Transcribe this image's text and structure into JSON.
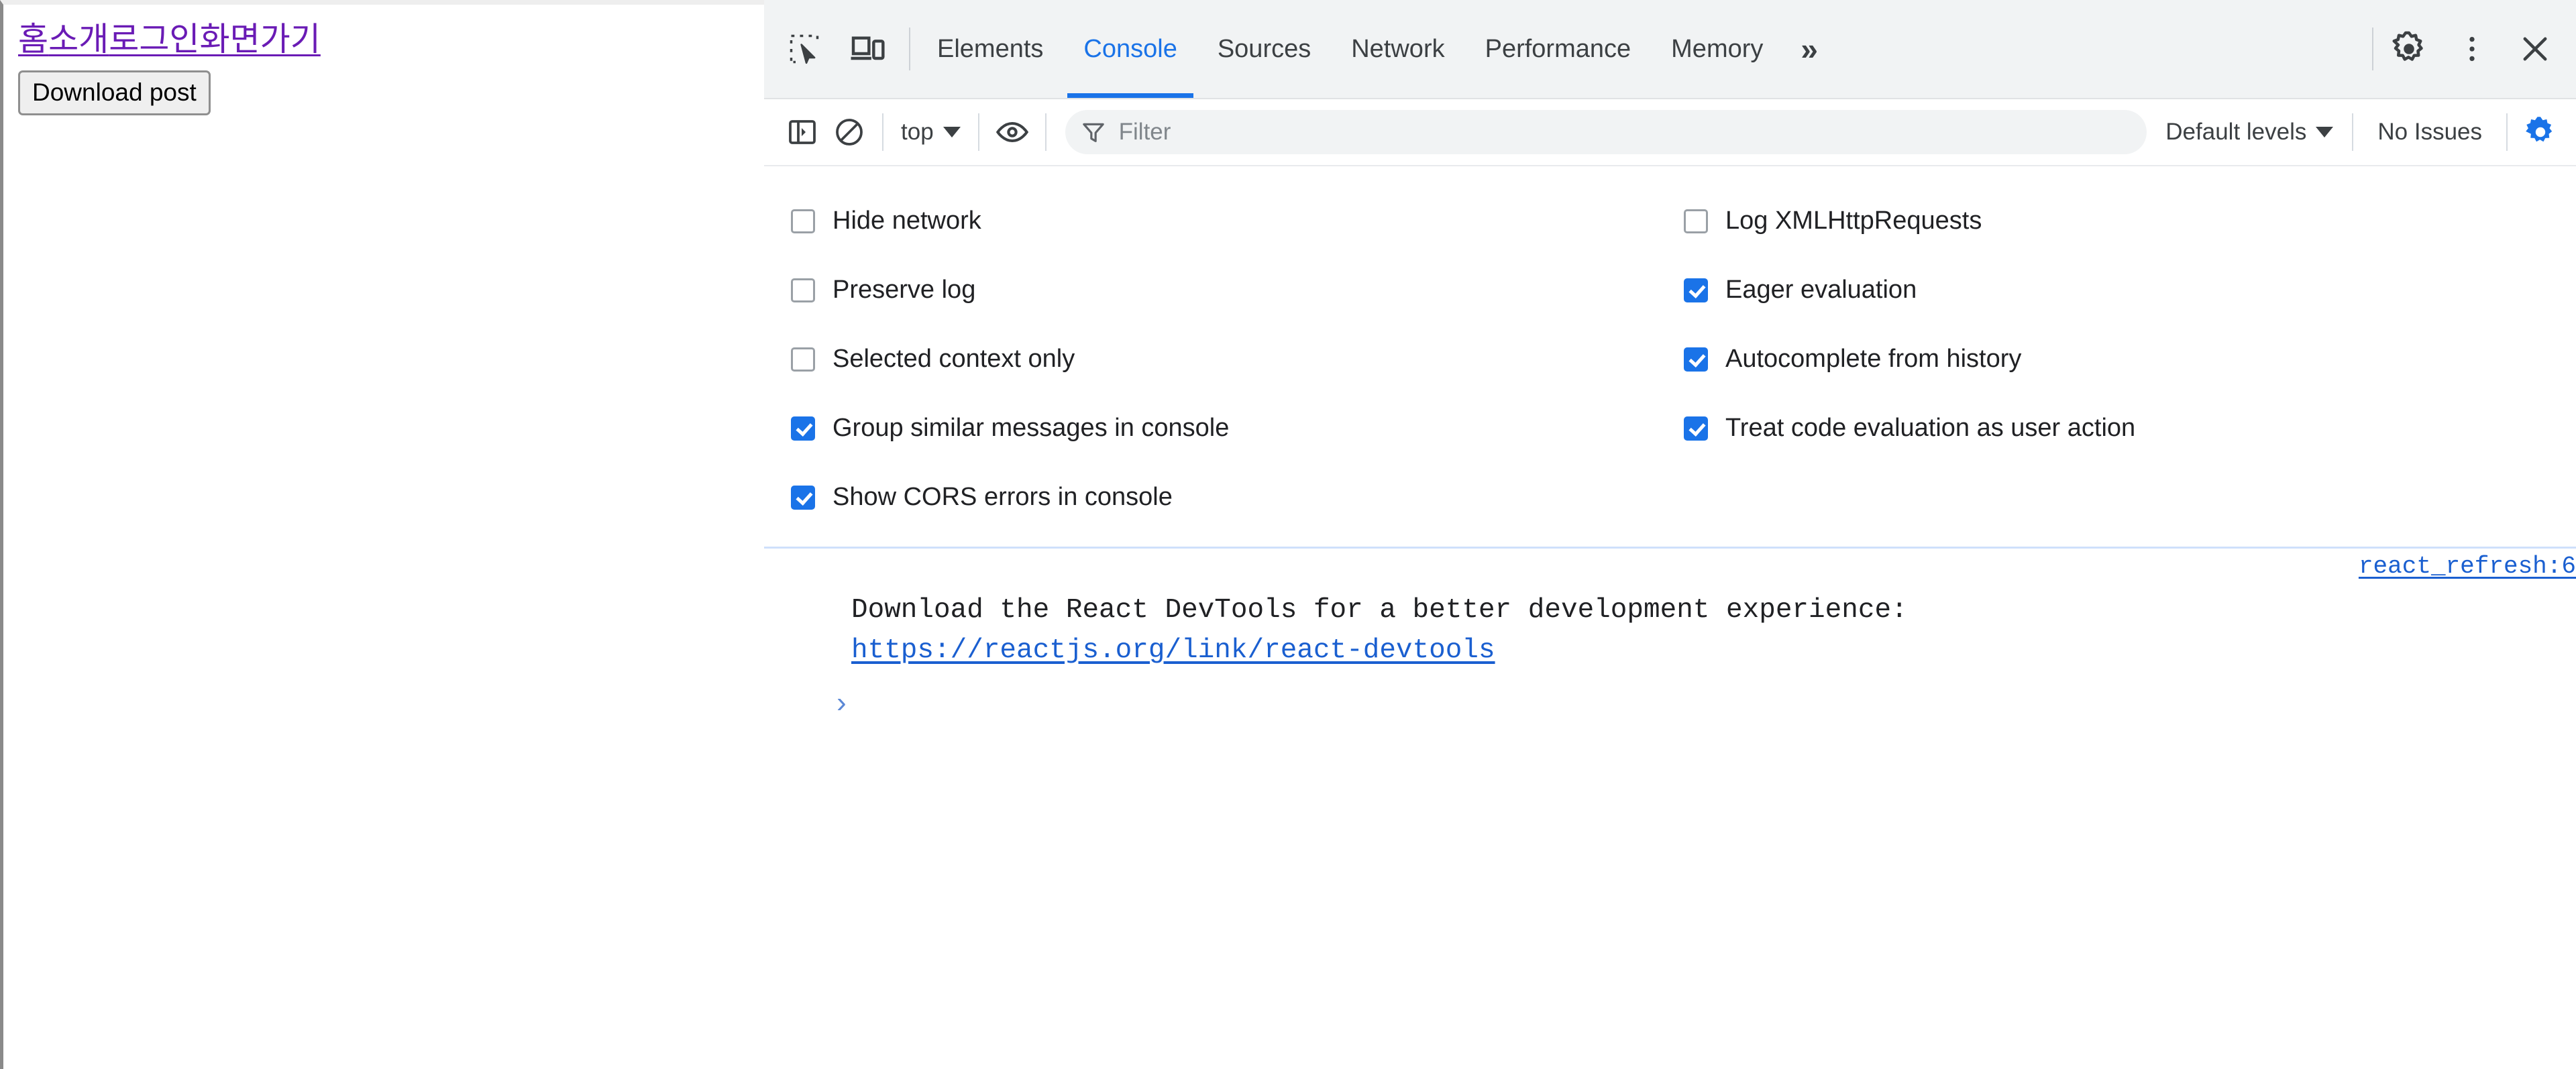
{
  "page": {
    "nav_links": [
      {
        "label": "홈"
      },
      {
        "label": "소개"
      },
      {
        "label": "로그인"
      },
      {
        "label": "화면가기"
      }
    ],
    "download_button": "Download post"
  },
  "devtools": {
    "tabstrip": {
      "inspect_icon": "inspect-element-icon",
      "device_icon": "device-toolbar-icon",
      "tabs": [
        {
          "label": "Elements",
          "active": false
        },
        {
          "label": "Console",
          "active": true
        },
        {
          "label": "Sources",
          "active": false
        },
        {
          "label": "Network",
          "active": false
        },
        {
          "label": "Performance",
          "active": false
        },
        {
          "label": "Memory",
          "active": false
        }
      ],
      "overflow_label": "»",
      "settings_icon": "gear-icon",
      "more_icon": "kebab-menu-icon",
      "close_icon": "close-icon"
    },
    "filterbar": {
      "sidebar_toggle_icon": "console-sidebar-icon",
      "clear_icon": "clear-console-icon",
      "context": "top",
      "eye_icon": "live-expression-eye-icon",
      "filter_icon": "funnel-icon",
      "filter_value": "",
      "filter_placeholder": "Filter",
      "levels": "Default levels",
      "issues": "No Issues",
      "settings_icon": "gear-icon-active"
    },
    "settings": {
      "left": [
        {
          "label": "Hide network",
          "checked": false
        },
        {
          "label": "Preserve log",
          "checked": false
        },
        {
          "label": "Selected context only",
          "checked": false
        },
        {
          "label": "Group similar messages in console",
          "checked": true
        },
        {
          "label": "Show CORS errors in console",
          "checked": true
        }
      ],
      "right": [
        {
          "label": "Log XMLHttpRequests",
          "checked": false
        },
        {
          "label": "Eager evaluation",
          "checked": true
        },
        {
          "label": "Autocomplete from history",
          "checked": true
        },
        {
          "label": "Treat code evaluation as user action",
          "checked": true
        }
      ]
    },
    "console": {
      "source_link": "react_refresh:6",
      "message_text": "Download the React DevTools for a better development experience:",
      "message_link": "https://reactjs.org/link/react-devtools",
      "prompt": "›"
    }
  },
  "colors": {
    "accent_blue": "#1a73e8",
    "link_blue": "#1a5fd0",
    "visited_purple": "#6a1bb5",
    "tabstrip_bg": "#f1f3f4",
    "separator": "#cfe0fb"
  }
}
